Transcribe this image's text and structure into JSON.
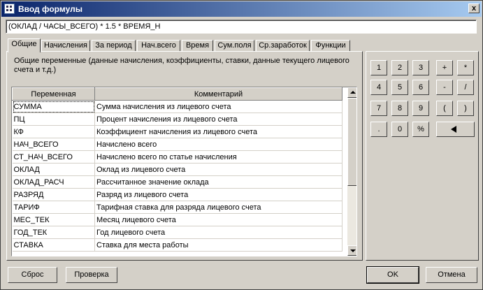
{
  "window": {
    "title": "Ввод формулы",
    "close_label": "x"
  },
  "formula": {
    "value": "(ОКЛАД / ЧАСЫ_ВСЕГО) * 1.5 * ВРЕМЯ_Н"
  },
  "tabs": [
    {
      "label": "Общие"
    },
    {
      "label": "Начисления"
    },
    {
      "label": "За период"
    },
    {
      "label": "Нач.всего"
    },
    {
      "label": "Время"
    },
    {
      "label": "Сум.поля"
    },
    {
      "label": "Ср.заработок"
    },
    {
      "label": "Функции"
    }
  ],
  "active_tab": "Общие",
  "panel": {
    "description": "Общие переменные (данные начисления, коэффициенты, ставки, данные текущего лицевого счета и т.д.)"
  },
  "grid": {
    "columns": {
      "variable": "Переменная",
      "comment": "Комментарий"
    },
    "rows": [
      {
        "variable": "СУММА",
        "comment": "Сумма начисления из лицевого счета"
      },
      {
        "variable": "ПЦ",
        "comment": "Процент начисления из лицевого счета"
      },
      {
        "variable": "КФ",
        "comment": "Коэффициент начисления из лицевого счета"
      },
      {
        "variable": "НАЧ_ВСЕГО",
        "comment": "Начислено всего"
      },
      {
        "variable": "СТ_НАЧ_ВСЕГО",
        "comment": "Начислено всего по статье начисления"
      },
      {
        "variable": "ОКЛАД",
        "comment": "Оклад из лицевого счета"
      },
      {
        "variable": "ОКЛАД_РАСЧ",
        "comment": "Рассчитанное значение оклада"
      },
      {
        "variable": "РАЗРЯД",
        "comment": "Разряд из лицевого счета"
      },
      {
        "variable": "ТАРИФ",
        "comment": "Тарифная ставка для разряда лицевого счета"
      },
      {
        "variable": "МЕС_ТЕК",
        "comment": "Месяц лицевого счета"
      },
      {
        "variable": "ГОД_ТЕК",
        "comment": "Год лицевого счета"
      },
      {
        "variable": "СТАВКА",
        "comment": "Ставка для места работы"
      }
    ]
  },
  "keypad": [
    {
      "label": "1",
      "name": "key-1"
    },
    {
      "label": "2",
      "name": "key-2"
    },
    {
      "label": "3",
      "name": "key-3"
    },
    {
      "label": "+",
      "name": "key-plus"
    },
    {
      "label": "*",
      "name": "key-multiply"
    },
    {
      "label": "4",
      "name": "key-4"
    },
    {
      "label": "5",
      "name": "key-5"
    },
    {
      "label": "6",
      "name": "key-6"
    },
    {
      "label": "-",
      "name": "key-minus"
    },
    {
      "label": "/",
      "name": "key-divide"
    },
    {
      "label": "7",
      "name": "key-7"
    },
    {
      "label": "8",
      "name": "key-8"
    },
    {
      "label": "9",
      "name": "key-9"
    },
    {
      "label": "(",
      "name": "key-open-paren"
    },
    {
      "label": ")",
      "name": "key-close-paren"
    },
    {
      "label": ".",
      "name": "key-dot"
    },
    {
      "label": "0",
      "name": "key-0"
    },
    {
      "label": "%",
      "name": "key-percent"
    }
  ],
  "backspace_icon": "back-arrow-icon",
  "buttons": {
    "reset": "Сброс",
    "check": "Проверка",
    "ok": "OK",
    "cancel": "Отмена"
  }
}
